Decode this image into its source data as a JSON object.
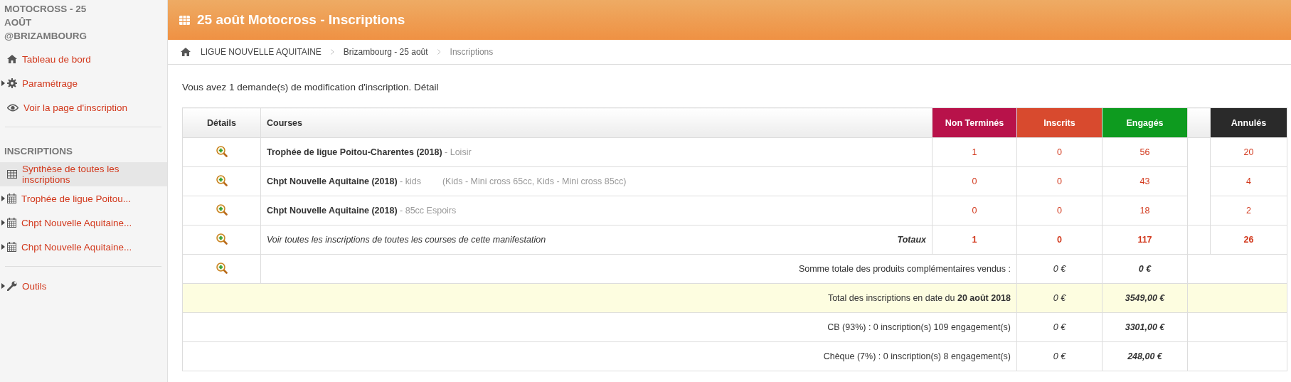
{
  "sidebar": {
    "title": "MOTOCROSS - 25 AOÛT @BRIZAMBOURG",
    "sections": [
      {
        "items": [
          {
            "label": "Tableau de bord",
            "expandable": false,
            "selected": false
          },
          {
            "label": "Paramétrage",
            "expandable": true,
            "selected": false
          },
          {
            "label": "Voir la page d'inscription",
            "expandable": false,
            "selected": false
          }
        ]
      },
      {
        "heading": "INSCRIPTIONS",
        "items": [
          {
            "label": "Synthèse de toutes les inscriptions",
            "expandable": false,
            "selected": true
          },
          {
            "label": "Trophée de ligue Poitou...",
            "expandable": true,
            "selected": false
          },
          {
            "label": "Chpt Nouvelle Aquitaine...",
            "expandable": true,
            "selected": false
          },
          {
            "label": "Chpt Nouvelle Aquitaine...",
            "expandable": true,
            "selected": false
          }
        ]
      },
      {
        "items": [
          {
            "label": "Outils",
            "expandable": true,
            "selected": false
          }
        ]
      }
    ]
  },
  "header": {
    "title": "25 août Motocross - Inscriptions"
  },
  "breadcrumb": [
    "LIGUE NOUVELLE AQUITAINE",
    "Brizambourg - 25 août",
    "Inscriptions"
  ],
  "message": "Vous avez 1 demande(s) de modification d'inscription. Détail",
  "table": {
    "columns": [
      {
        "label": "Détails"
      },
      {
        "label": "Courses"
      },
      {
        "label": "Non Terminés",
        "color": "#b8124a"
      },
      {
        "label": "Inscrits",
        "color": "#d84a2e"
      },
      {
        "label": "Engagés",
        "color": "#0e9b1f"
      },
      {
        "label": "Annulés",
        "color": "#2a2a2a"
      }
    ],
    "rows": [
      {
        "name": "Trophée de ligue Poitou-Charentes (2018)",
        "category": "- Loisir",
        "non_termines": "1",
        "inscrits": "0",
        "engages": "56",
        "annules": "20"
      },
      {
        "name": "Chpt Nouvelle Aquitaine (2018)",
        "category": "- kids",
        "note": "(Kids - Mini cross 65cc, Kids - Mini cross 85cc)",
        "non_termines": "0",
        "inscrits": "0",
        "engages": "43",
        "annules": "4"
      },
      {
        "name": "Chpt Nouvelle Aquitaine (2018)",
        "category": "- 85cc Espoirs",
        "non_termines": "0",
        "inscrits": "0",
        "engages": "18",
        "annules": "2"
      }
    ],
    "totals": {
      "link": "Voir toutes les inscriptions de toutes les courses de cette manifestation",
      "label": "Totaux",
      "non_termines": "1",
      "inscrits": "0",
      "engages": "117",
      "annules": "26"
    },
    "summary": [
      {
        "kind": "products",
        "label": "Somme totale des produits complémentaires vendus :",
        "inscrits": "0 €",
        "engages": "0 €",
        "highlighted": false
      },
      {
        "kind": "payment",
        "label": "Total des inscriptions en date du **20 août 2018**",
        "inscrits": "0 €",
        "engages": "3549,00 €",
        "highlighted": true
      },
      {
        "kind": "payment",
        "label": "CB (93%) : 0 inscription(s) 109 engagement(s)",
        "inscrits": "0 €",
        "engages": "3301,00 €",
        "highlighted": false
      },
      {
        "kind": "payment",
        "label": "Chèque (7%) : 0 inscription(s) 8 engagement(s)",
        "inscrits": "0 €",
        "engages": "248,00 €",
        "highlighted": false
      }
    ]
  }
}
